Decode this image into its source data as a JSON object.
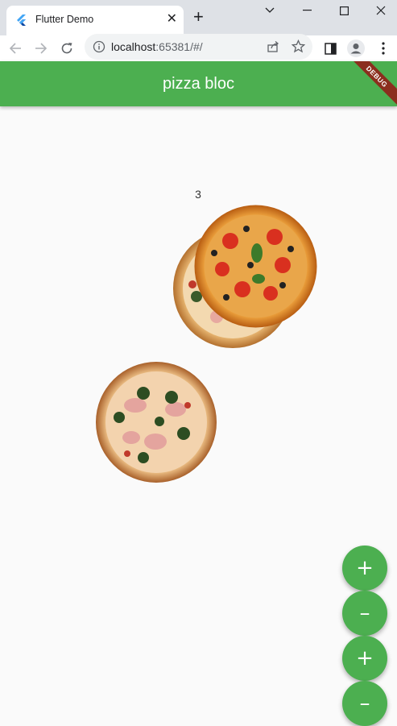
{
  "browser": {
    "tab_title": "Flutter Demo",
    "url_host": "localhost",
    "url_rest": ":65381/#/"
  },
  "app": {
    "title": "pizza bloc",
    "debug_label": "DEBUG",
    "counter": "3"
  },
  "fabs": [
    "+",
    "–",
    "+",
    "–"
  ],
  "colors": {
    "primary": "#4caf50",
    "debug": "#8b2e1e"
  }
}
